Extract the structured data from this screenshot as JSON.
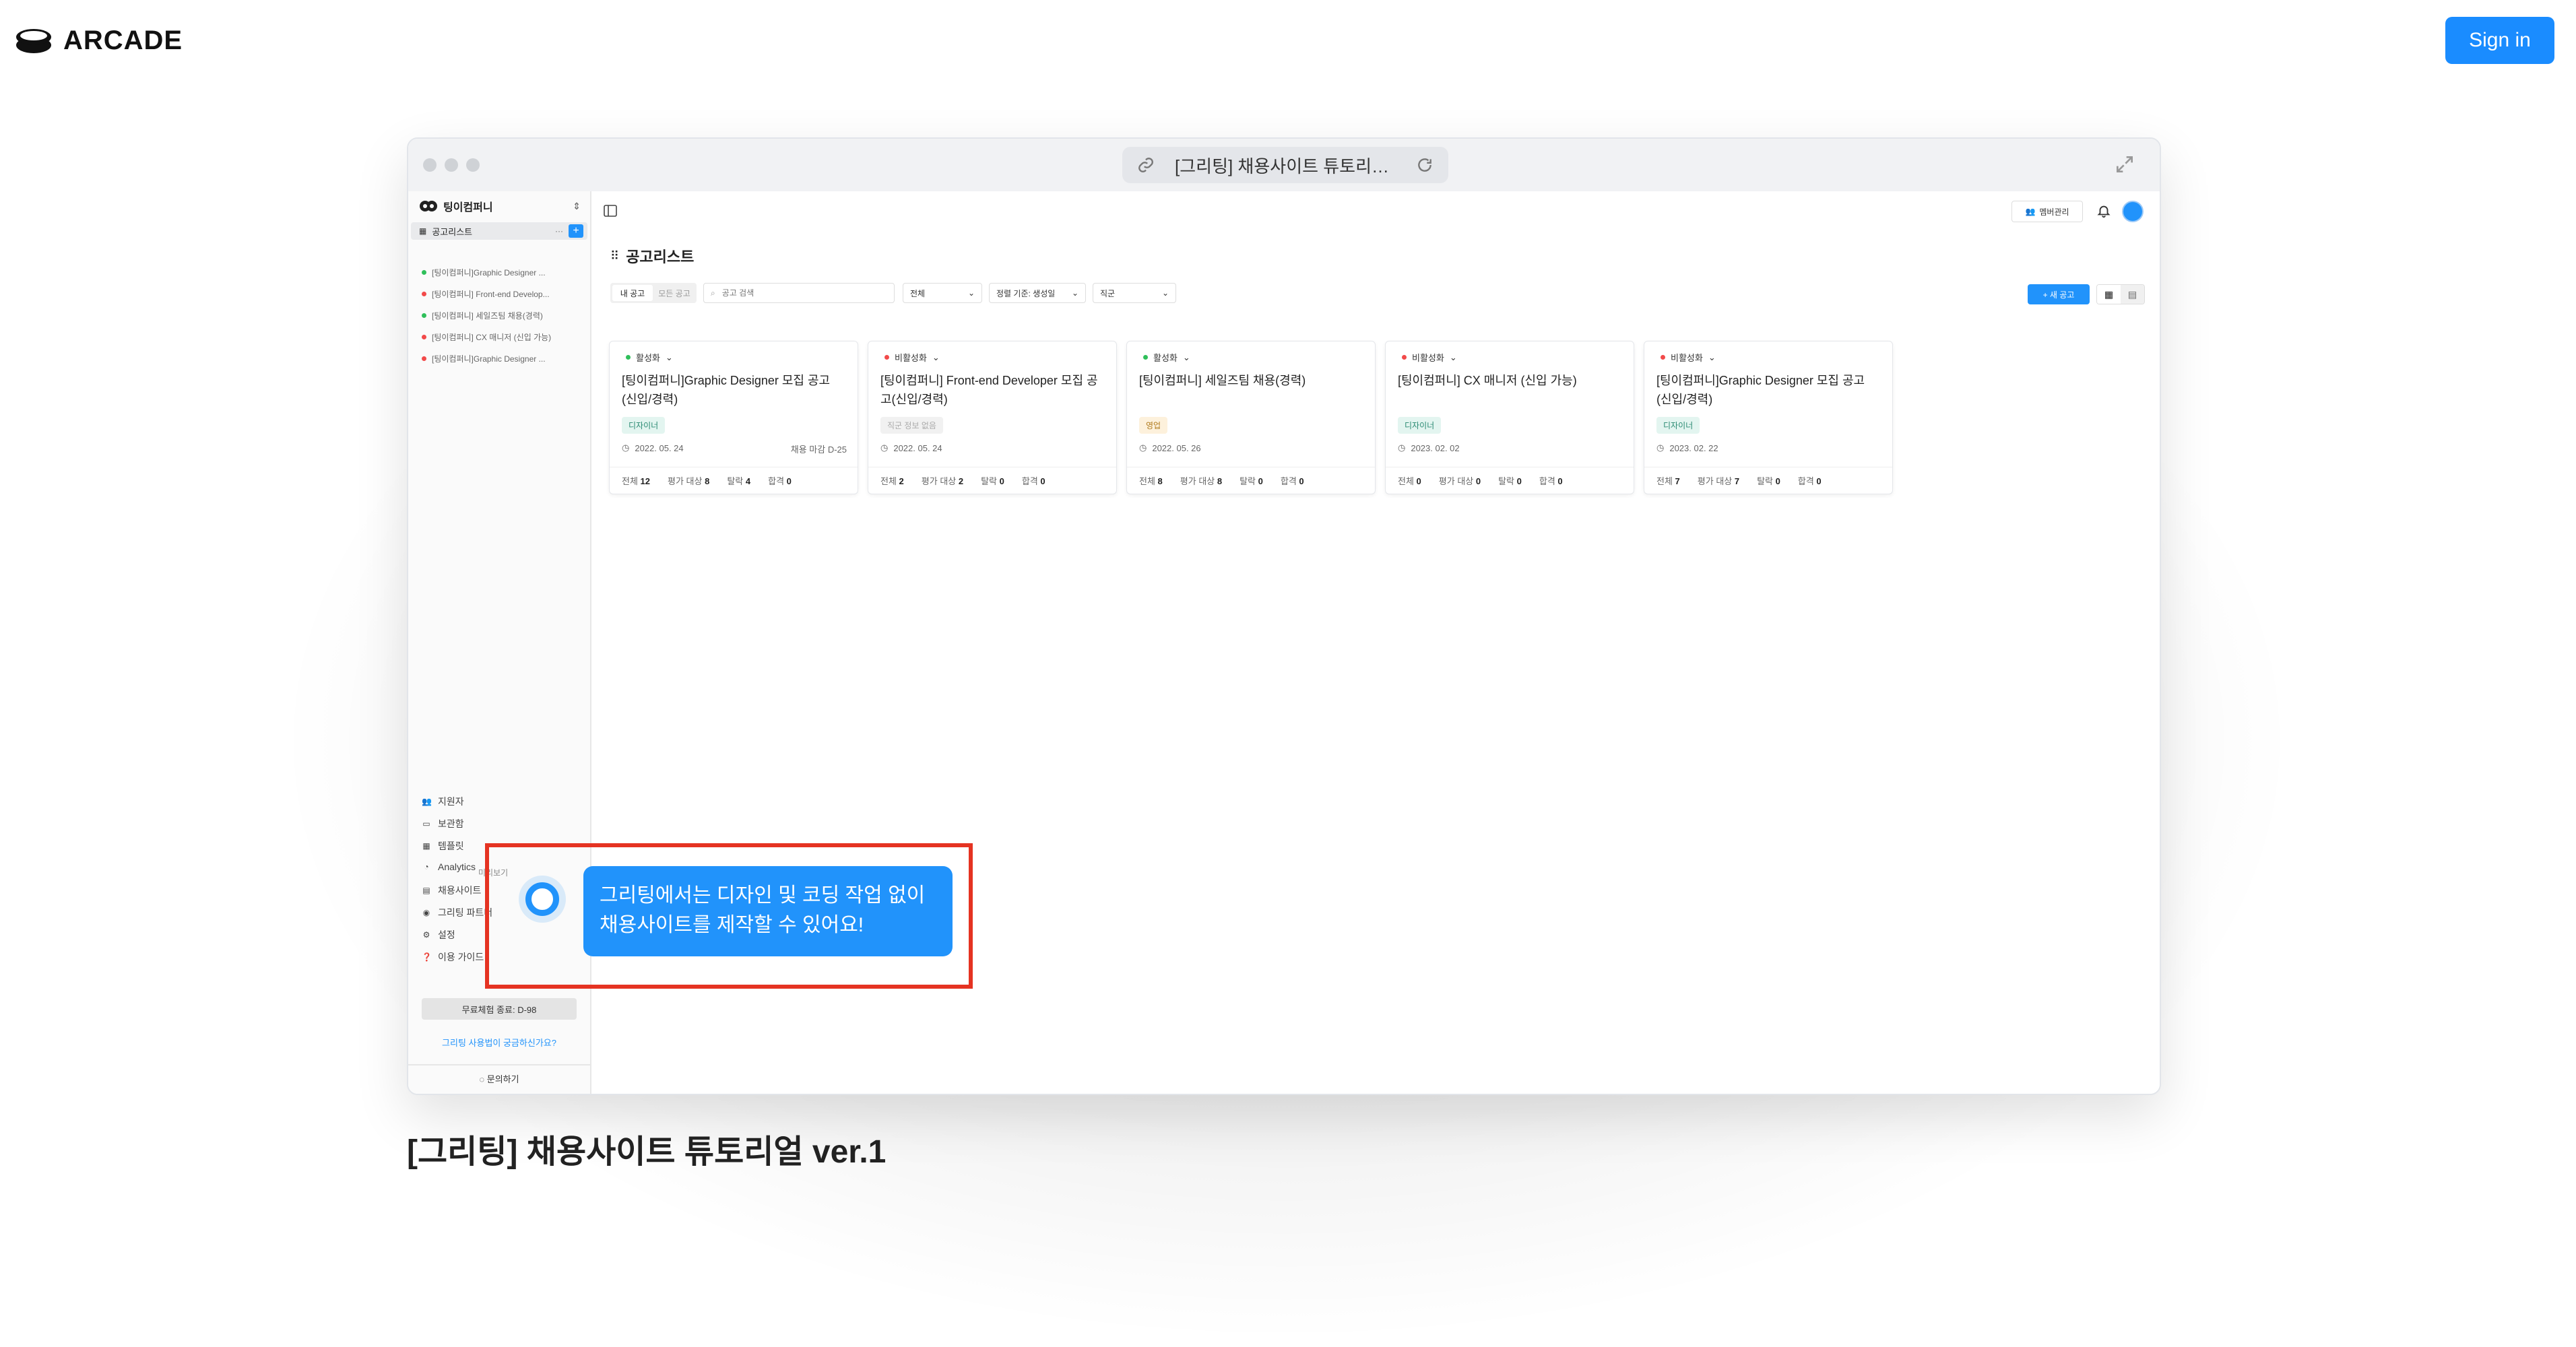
{
  "site": {
    "logo_text": "ARCADE",
    "sign_in_label": "Sign in",
    "caption": "[그리팅] 채용사이트 튜토리얼 ver.1",
    "accent": "#1a8cff"
  },
  "browser": {
    "url_title": "[그리팅] 채용사이트 튜토리얼 ..."
  },
  "app": {
    "company_name": "팅이컴퍼니",
    "sidebar_section": "공고리스트",
    "jobs_list": [
      {
        "label": "[팅이컴퍼니]Graphic Designer ...",
        "dot": "#2fbf5a"
      },
      {
        "label": "[팅이컴퍼니] Front-end Develop...",
        "dot": "#f24a4a"
      },
      {
        "label": "[팅이컴퍼니] 세일즈팀 채용(경력)",
        "dot": "#2fbf5a"
      },
      {
        "label": "[팅이컴퍼니] CX 매니저 (신입 가능)",
        "dot": "#f24a4a"
      },
      {
        "label": "[팅이컴퍼니]Graphic Designer ...",
        "dot": "#f24a4a"
      }
    ],
    "menu": [
      {
        "label": "지원자",
        "icon": "people-icon"
      },
      {
        "label": "보관함",
        "icon": "inbox-icon"
      },
      {
        "label": "템플릿",
        "icon": "grid-icon"
      },
      {
        "label": "Analytics",
        "icon": "chart-icon"
      },
      {
        "label": "채용사이트",
        "icon": "window-icon"
      },
      {
        "label": "그리팅 파트너",
        "icon": "eye-icon"
      },
      {
        "label": "설정",
        "icon": "gear-icon"
      },
      {
        "label": "이용 가이드",
        "icon": "help-icon"
      }
    ],
    "trial_label": "무료체험 종료: D-98",
    "survey_link": "그리팅 사용법이 궁금하신가요?",
    "contact_label": "문의하기",
    "member_button": "멤버관리",
    "page_title": "공고리스트",
    "filters": {
      "my_jobs": "내 공고",
      "all_jobs": "모든 공고",
      "search_placeholder": "공고 검색",
      "scope": "전체",
      "sort": "정렬 기준: 생성일",
      "job_type": "직군",
      "new_job": "+ 새 공고"
    },
    "cards": [
      {
        "status": "활성화",
        "status_color": "#2fbf5a",
        "title": "[팅이컴퍼니]Graphic Designer 모집 공고(신입/경력)",
        "tag": "디자이너",
        "tag_bg": "#e3f5f0",
        "tag_color": "#2a8a72",
        "date": "2022. 05. 24",
        "extra": "채용 마감 D-25",
        "total": "12",
        "eval": "8",
        "fail": "4",
        "pass": "0"
      },
      {
        "status": "비활성화",
        "status_color": "#f24a4a",
        "title": "[팅이컴퍼니] Front-end Developer 모집 공고(신입/경력)",
        "tag": "직군 정보 없음",
        "tag_bg": "#f1f1f1",
        "tag_color": "#aaa",
        "date": "2022. 05. 24",
        "extra": "",
        "total": "2",
        "eval": "2",
        "fail": "0",
        "pass": "0"
      },
      {
        "status": "활성화",
        "status_color": "#2fbf5a",
        "title": "[팅이컴퍼니] 세일즈팀 채용(경력)",
        "tag": "영업",
        "tag_bg": "#fdf1dc",
        "tag_color": "#b07a1b",
        "date": "2022. 05. 26",
        "extra": "",
        "total": "8",
        "eval": "8",
        "fail": "0",
        "pass": "0"
      },
      {
        "status": "비활성화",
        "status_color": "#f24a4a",
        "title": "[팅이컴퍼니] CX 매니저 (신입 가능)",
        "tag": "디자이너",
        "tag_bg": "#e3f5f0",
        "tag_color": "#2a8a72",
        "date": "2023. 02. 02",
        "extra": "",
        "total": "0",
        "eval": "0",
        "fail": "0",
        "pass": "0"
      },
      {
        "status": "비활성화",
        "status_color": "#f24a4a",
        "title": "[팅이컴퍼니]Graphic Designer 모집 공고(신입/경력)",
        "tag": "디자이너",
        "tag_bg": "#e3f5f0",
        "tag_color": "#2a8a72",
        "date": "2023. 02. 22",
        "extra": "",
        "total": "7",
        "eval": "7",
        "fail": "0",
        "pass": "0"
      }
    ],
    "stat_labels": {
      "total": "전체",
      "eval": "평가 대상",
      "fail": "탈락",
      "pass": "합격"
    },
    "hidden_label_fragment": "채용사이트",
    "preview_label": "미리보기"
  },
  "tooltip": {
    "line1": "그리팅에서는 디자인 및 코딩 작업 없이",
    "line2": "채용사이트를 제작할 수 있어요!",
    "color": "#2193fb",
    "highlight_color": "#e53322"
  }
}
